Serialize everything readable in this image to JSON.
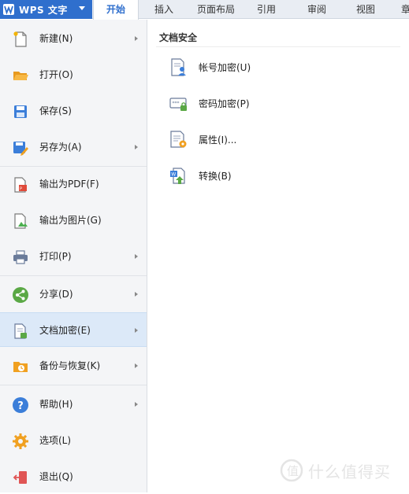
{
  "app": {
    "title": "WPS 文字"
  },
  "tabs": [
    {
      "label": "开始",
      "active": true
    },
    {
      "label": "插入"
    },
    {
      "label": "页面布局"
    },
    {
      "label": "引用"
    },
    {
      "label": "审阅"
    },
    {
      "label": "视图"
    },
    {
      "label": "章"
    }
  ],
  "menu": {
    "items": [
      {
        "label": "新建(N)",
        "icon": "new-file-icon",
        "submenu": true
      },
      {
        "label": "打开(O)",
        "icon": "folder-open-icon",
        "submenu": false
      },
      {
        "label": "保存(S)",
        "icon": "save-icon",
        "submenu": false
      },
      {
        "label": "另存为(A)",
        "icon": "save-as-icon",
        "submenu": true
      },
      {
        "label": "输出为PDF(F)",
        "icon": "pdf-icon",
        "submenu": false
      },
      {
        "label": "输出为图片(G)",
        "icon": "image-export-icon",
        "submenu": false
      },
      {
        "label": "打印(P)",
        "icon": "printer-icon",
        "submenu": true
      },
      {
        "label": "分享(D)",
        "icon": "share-icon",
        "submenu": true
      },
      {
        "label": "文档加密(E)",
        "icon": "doc-encrypt-icon",
        "submenu": true,
        "selected": true
      },
      {
        "label": "备份与恢复(K)",
        "icon": "backup-icon",
        "submenu": true
      },
      {
        "label": "帮助(H)",
        "icon": "help-icon",
        "submenu": true
      },
      {
        "label": "选项(L)",
        "icon": "gear-icon",
        "submenu": false
      },
      {
        "label": "退出(Q)",
        "icon": "exit-icon",
        "submenu": false
      }
    ]
  },
  "panel": {
    "title": "文档安全",
    "items": [
      {
        "label": "帐号加密(U)",
        "icon": "account-encrypt-icon"
      },
      {
        "label": "密码加密(P)",
        "icon": "password-encrypt-icon"
      },
      {
        "label": "属性(I)...",
        "icon": "properties-icon"
      },
      {
        "label": "转换(B)",
        "icon": "convert-icon"
      }
    ]
  },
  "watermark": {
    "text": "什么值得买"
  },
  "colors": {
    "accent": "#2f6fcd",
    "menu_bg": "#f4f5f7",
    "selected_bg": "#dce9f8"
  }
}
